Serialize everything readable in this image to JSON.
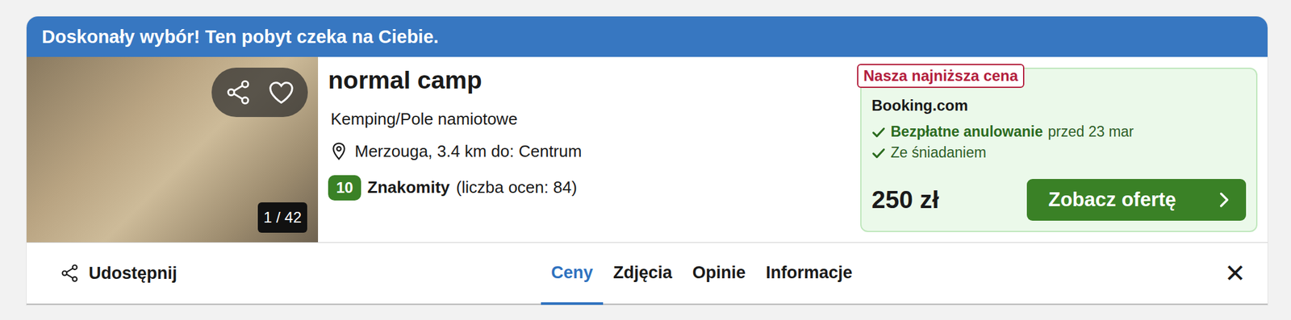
{
  "banner": {
    "text": "Doskonały wybór! Ten pobyt czeka na Ciebie."
  },
  "photo": {
    "counter": "1 / 42",
    "saved": false
  },
  "hotel": {
    "name": "normal camp",
    "type": "Kemping/Pole namiotowe",
    "location": "Merzouga, 3.4 km do: Centrum",
    "rating": {
      "score": "10",
      "label": "Znakomity",
      "count": "(liczba ocen: 84)"
    }
  },
  "offer": {
    "badge": "Nasza najniższa cena",
    "provider": "Booking.com",
    "features": [
      {
        "label": "Bezpłatne anulowanie",
        "note": "przed 23 mar",
        "kind": "highlight"
      },
      {
        "label": "Ze śniadaniem",
        "kind": "plain"
      }
    ],
    "price": "250 zł",
    "button": "Zobacz ofertę"
  },
  "bar": {
    "share": "Udostępnij",
    "tabs": [
      {
        "label": "Ceny",
        "selected": true
      },
      {
        "label": "Zdjęcia",
        "selected": false
      },
      {
        "label": "Opinie",
        "selected": false
      },
      {
        "label": "Informacje",
        "selected": false
      }
    ],
    "close": "✕"
  }
}
